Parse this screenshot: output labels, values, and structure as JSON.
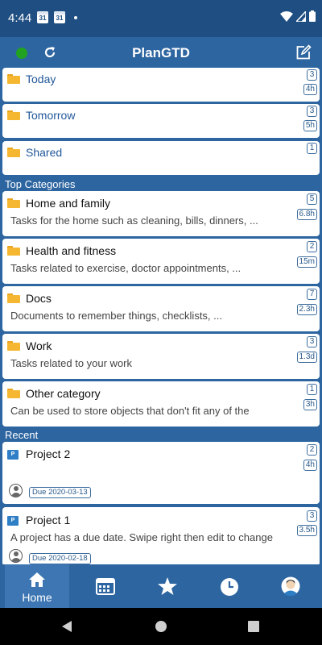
{
  "status_bar": {
    "time": "4:44",
    "cal1": "31",
    "cal2": "31"
  },
  "app": {
    "title": "PlanGTD"
  },
  "nav_lists": [
    {
      "label": "Today",
      "count": "3",
      "duration": "4h"
    },
    {
      "label": "Tomorrow",
      "count": "3",
      "duration": "5h"
    },
    {
      "label": "Shared",
      "count": "1"
    }
  ],
  "sections": {
    "top_categories": "Top Categories",
    "recent": "Recent"
  },
  "categories": [
    {
      "name": "Home and family",
      "description": "Tasks for the home such as cleaning, bills, dinners, ...",
      "count": "5",
      "duration": "6.8h"
    },
    {
      "name": "Health and fitness",
      "description": "Tasks related to exercise, doctor appointments, ...",
      "count": "2",
      "duration": "15m"
    },
    {
      "name": "Docs",
      "description": "Documents to remember things, checklists, ...",
      "count": "7",
      "duration": "2.3h"
    },
    {
      "name": "Work",
      "description": "Tasks related to your work",
      "count": "3",
      "duration": "1.3d"
    },
    {
      "name": "Other category",
      "description": "Can be used to store objects that don't fit any of the",
      "count": "1",
      "duration": "3h"
    }
  ],
  "recent": [
    {
      "name": "Project 2",
      "description": "",
      "count": "2",
      "duration": "4h",
      "due": "Due 2020-03-13",
      "flag": "P"
    },
    {
      "name": "Project 1",
      "description": "A project has a due date. Swipe right then edit to change",
      "count": "3",
      "duration": "3.5h",
      "due": "Due 2020-02-18",
      "flag": "P"
    }
  ],
  "bottom_nav": {
    "home_label": "Home",
    "active": "home"
  },
  "colors": {
    "primary": "#2d65a0",
    "statusbar": "#1f4f82",
    "accent_green": "#21a321",
    "folder": "#f5b731"
  }
}
